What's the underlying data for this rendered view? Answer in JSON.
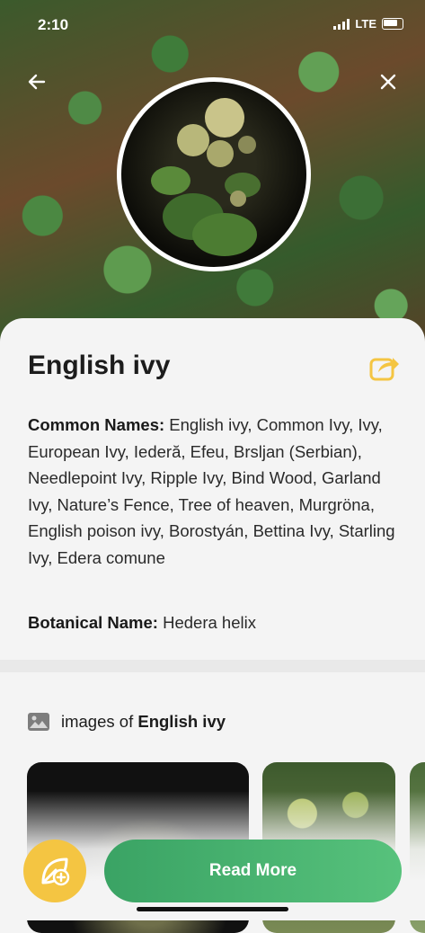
{
  "status_bar": {
    "time": "2:10",
    "network": "LTE"
  },
  "header": {
    "back_icon": "arrow-left-icon",
    "close_icon": "close-icon"
  },
  "plant": {
    "name": "English ivy",
    "common_names_label": "Common Names:",
    "common_names_value": "English ivy, Common Ivy, Ivy, European Ivy, Iederă, Efeu, Brsljan (Serbian), Needlepoint Ivy, Ripple Ivy, Bind Wood, Garland Ivy, Nature’s Fence, Tree of heaven, Murgröna, English poison ivy, Borostyán, Bettina Ivy, Starling Ivy, Edera comune",
    "botanical_name_label": "Botanical Name:",
    "botanical_name_value": "Hedera helix"
  },
  "images": {
    "prefix": "images of",
    "plant_name": "English ivy"
  },
  "actions": {
    "read_more": "Read More"
  },
  "colors": {
    "accent_green": "#3aa364",
    "accent_yellow": "#f4c542"
  }
}
